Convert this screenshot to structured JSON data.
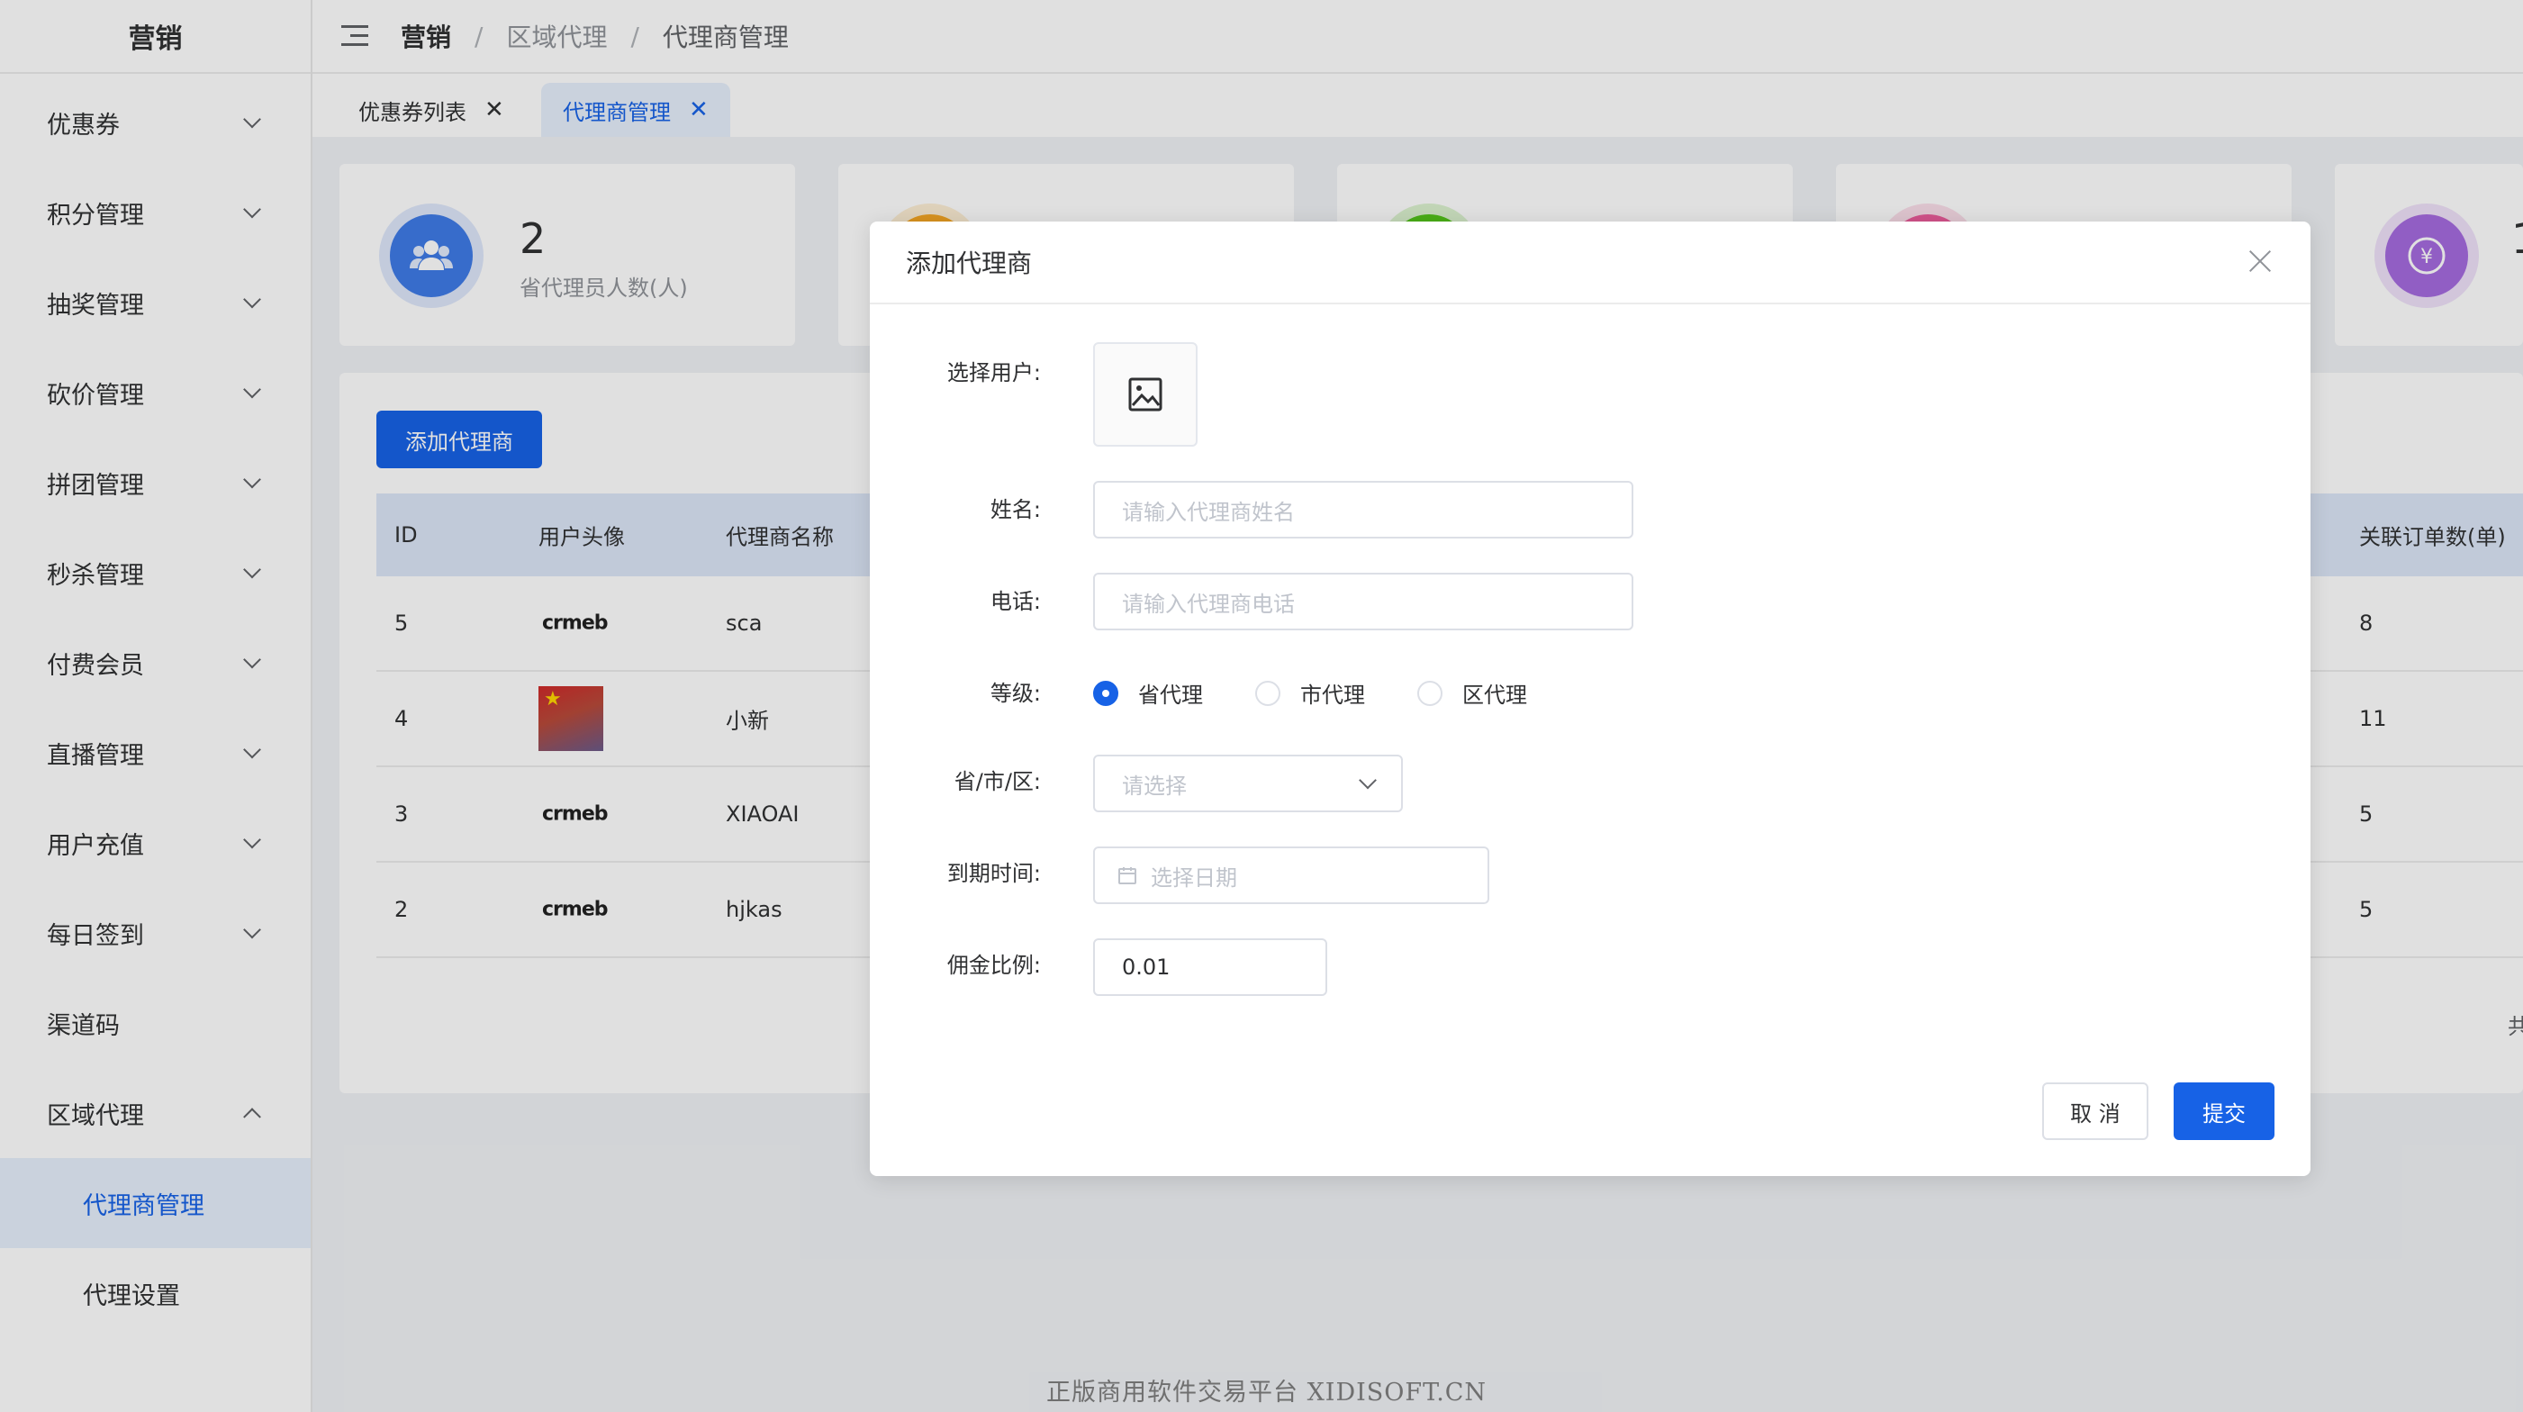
{
  "sidebar": {
    "title": "营销",
    "items": [
      {
        "label": "优惠券"
      },
      {
        "label": "积分管理"
      },
      {
        "label": "抽奖管理"
      },
      {
        "label": "砍价管理"
      },
      {
        "label": "拼团管理"
      },
      {
        "label": "秒杀管理"
      },
      {
        "label": "付费会员"
      },
      {
        "label": "直播管理"
      },
      {
        "label": "用户充值"
      },
      {
        "label": "每日签到"
      },
      {
        "label": "渠道码"
      },
      {
        "label": "区域代理"
      }
    ],
    "sub_items": [
      {
        "label": "代理商管理",
        "active": true
      },
      {
        "label": "代理设置",
        "active": false
      }
    ]
  },
  "breadcrumb": {
    "root": "营销",
    "sep": "/",
    "mid": "区域代理",
    "last": "代理商管理"
  },
  "tabs": [
    {
      "label": "优惠券列表",
      "close": "✕"
    },
    {
      "label": "代理商管理",
      "close": "✕",
      "active": true
    }
  ],
  "stats": [
    {
      "value": "2",
      "label": "省代理员人数(人)",
      "color": "#3f7be8",
      "icon": "users-icon"
    },
    {
      "value": "",
      "label": "",
      "color": "#f5a623",
      "icon": ""
    },
    {
      "value": "",
      "label": "",
      "color": "#52c41a",
      "icon": ""
    },
    {
      "value": "",
      "label": "",
      "color": "#ec5d9b",
      "icon": ""
    },
    {
      "value": "1",
      "label": "",
      "color": "#a66be0",
      "icon": "yen-exchange-icon"
    }
  ],
  "main": {
    "add_button": "添加代理商",
    "columns": [
      "ID",
      "用户头像",
      "代理商名称",
      "关联订单数(单)"
    ],
    "rows": [
      {
        "id": "5",
        "avatar": "crmeb",
        "name": "sca",
        "orders": "8"
      },
      {
        "id": "4",
        "avatar": "photo",
        "name": "小新",
        "orders": "11"
      },
      {
        "id": "3",
        "avatar": "crmeb",
        "name": "XIAOAI",
        "orders": "5"
      },
      {
        "id": "2",
        "avatar": "crmeb",
        "name": "hjkas",
        "orders": "5"
      }
    ],
    "pagination_partial": "共"
  },
  "modal": {
    "title": "添加代理商",
    "labels": {
      "user": "选择用户:",
      "name": "姓名:",
      "phone": "电话:",
      "level": "等级:",
      "region": "省/市/区:",
      "expire": "到期时间:",
      "commission": "佣金比例:"
    },
    "name_placeholder": "请输入代理商姓名",
    "phone_placeholder": "请输入代理商电话",
    "levels": [
      "省代理",
      "市代理",
      "区代理"
    ],
    "selected_level": "省代理",
    "region_placeholder": "请选择",
    "date_placeholder": "选择日期",
    "commission_value": "0.01",
    "cancel": "取 消",
    "submit": "提交"
  },
  "crmeb_logo_text": "crmeb",
  "footer_watermark": "正版商用软件交易平台 XIDISOFT.CN"
}
